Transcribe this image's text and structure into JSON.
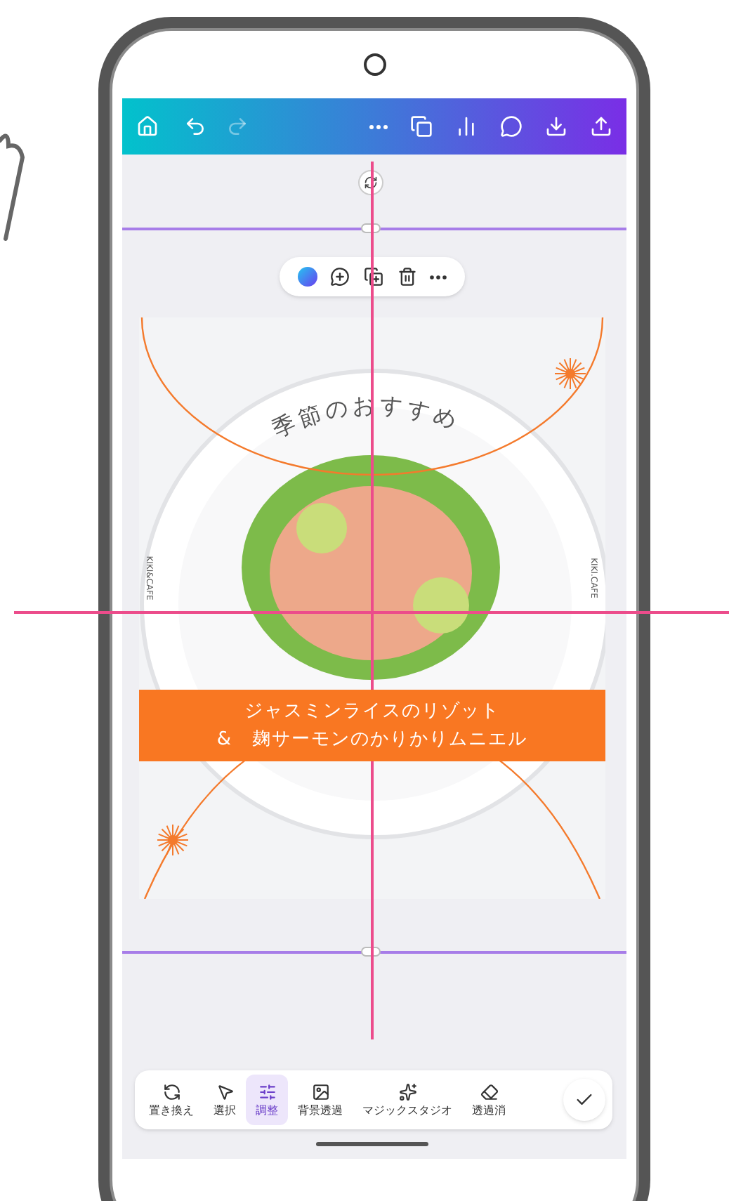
{
  "top_toolbar": {
    "undo": {
      "disabled": false
    },
    "redo": {
      "disabled": true
    }
  },
  "design": {
    "headline": "季節のおすすめ",
    "side_text_left": "KIKI&CAFE",
    "side_text_right": "KIKI.CAFE",
    "banner_lines": [
      "ジャスミンライスのリゾット",
      "&　麹サーモンのかりかりムニエル"
    ]
  },
  "bottom_tools": [
    {
      "kind": "replace",
      "label": "置き換え",
      "selected": false
    },
    {
      "kind": "select",
      "label": "選択",
      "selected": false
    },
    {
      "kind": "adjust",
      "label": "調整",
      "selected": true
    },
    {
      "kind": "bg-remove",
      "label": "背景透過",
      "selected": false
    },
    {
      "kind": "magic",
      "label": "マジックスタジオ",
      "selected": false
    },
    {
      "kind": "erase",
      "label": "透過消",
      "selected": false
    }
  ]
}
